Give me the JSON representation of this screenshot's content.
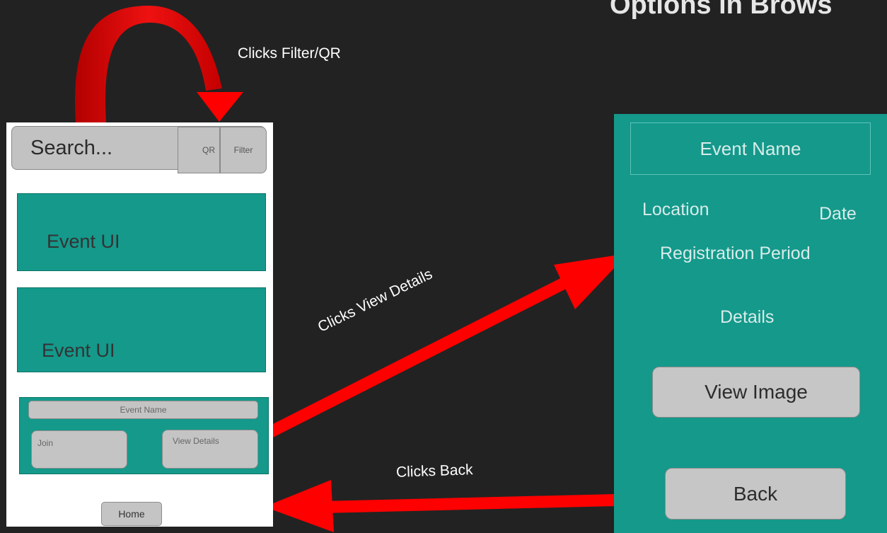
{
  "slide_title": "Options in Brows",
  "captions": {
    "filter_qr": "Clicks Filter/QR",
    "view_details": "Clicks View Details",
    "back": "Clicks Back"
  },
  "left_screen": {
    "search_placeholder": "Search...",
    "qr_label": "QR",
    "filter_label": "Filter",
    "event_cards": [
      "Event UI",
      "Event UI"
    ],
    "expanded_card": {
      "event_name": "Event Name",
      "join_label": "Join",
      "view_details_label": "View Details"
    },
    "home_label": "Home"
  },
  "right_screen": {
    "event_name": "Event Name",
    "location": "Location",
    "date": "Date",
    "registration_period": "Registration Period",
    "details": "Details",
    "view_image_label": "View Image",
    "back_label": "Back"
  },
  "colors": {
    "background": "#222222",
    "teal": "#14998b",
    "arrow_red": "#ff0000",
    "curve_red": "#d40000"
  }
}
